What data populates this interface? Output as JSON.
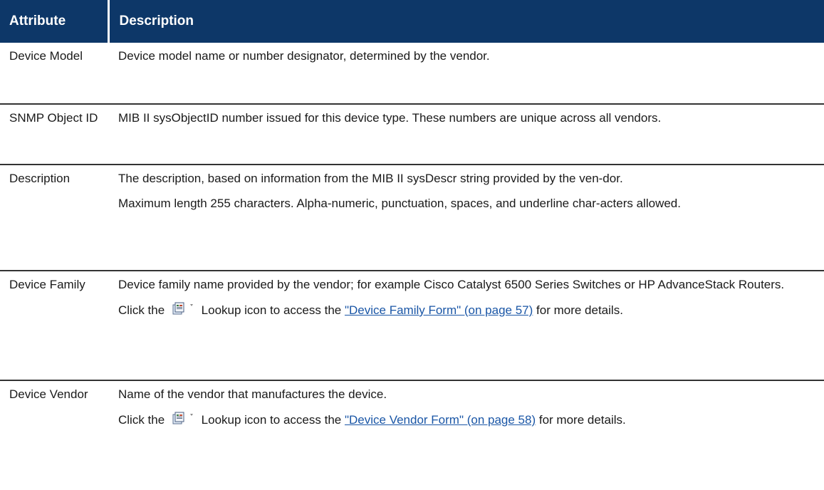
{
  "table": {
    "headers": {
      "attribute": "Attribute",
      "description": "Description"
    },
    "rows": [
      {
        "attribute": "Device Model",
        "description": [
          "Device model name or number designator, determined by the vendor."
        ]
      },
      {
        "attribute": "SNMP Object ID",
        "description": [
          "MIB II sysObjectID number issued for this device type. These numbers are unique across all vendors."
        ]
      },
      {
        "attribute": "Description",
        "description": [
          "The description, based on information from the MIB II sysDescr string provided by the ven-dor.",
          "Maximum length 255 characters. Alpha-numeric, punctuation, spaces, and underline char-acters allowed."
        ]
      },
      {
        "attribute": "Device Family",
        "description": [
          "Device family name provided by the vendor; for example Cisco Catalyst 6500 Series Switches or HP AdvanceStack Routers."
        ],
        "lookup": {
          "before": "Click the",
          "icon": "lookup-icon",
          "after": "Lookup icon to access the",
          "link": "\"Device Family Form\" (on page 57)",
          "tail": "for more details."
        }
      },
      {
        "attribute": "Device Vendor",
        "description": [
          "Name of the vendor that manufactures the device."
        ],
        "lookup": {
          "before": "Click the",
          "icon": "lookup-icon",
          "after": "Lookup icon to access the",
          "link": "\"Device Vendor Form\" (on page 58)",
          "tail": "for more details."
        }
      }
    ]
  },
  "colors": {
    "header_bg": "#0d3768",
    "header_text": "#ffffff",
    "link": "#1a56a6",
    "row_border": "#333333"
  }
}
